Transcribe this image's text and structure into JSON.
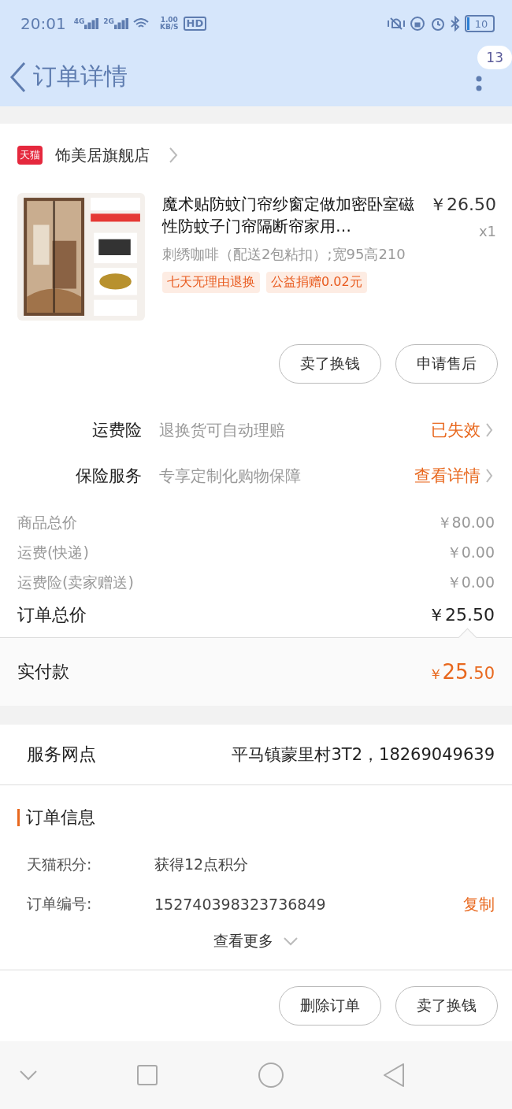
{
  "status_bar": {
    "time": "20:01",
    "signals": [
      "4G",
      "2G"
    ],
    "speed": "1.00",
    "speed_unit": "KB/S",
    "hd": "HD",
    "battery": "10"
  },
  "header": {
    "title": "订单详情",
    "badge": "13"
  },
  "store": {
    "badge": "天猫",
    "name": "饰美居旗舰店"
  },
  "product": {
    "image": {
      "kind": "picture"
    },
    "title": "魔术贴防蚊门帘纱窗定做加密卧室磁性防蚊子门帘隔断帘家用…",
    "price": "￥26.50",
    "quantity": "x1",
    "spec": "刺绣咖啡（配送2包粘扣）;宽95高210",
    "tags": [
      "七天无理由退换",
      "公益捐赠0.02元"
    ]
  },
  "item_buttons": [
    "卖了换钱",
    "申请售后"
  ],
  "services": [
    {
      "label": "运费险",
      "desc": "退换货可自动理赔",
      "action": "已失效"
    },
    {
      "label": "保险服务",
      "desc": "专享定制化购物保障",
      "action": "查看详情"
    }
  ],
  "summary": [
    {
      "label": "商品总价",
      "value": "￥80.00"
    },
    {
      "label": "运费(快递)",
      "value": "￥0.00"
    },
    {
      "label": "运费险(卖家赠送)",
      "value": "￥0.00"
    }
  ],
  "order_total": {
    "label": "订单总价",
    "value": "￥25.50"
  },
  "paid": {
    "label": "实付款",
    "currency": "￥",
    "integer": "25",
    "decimal": ".50"
  },
  "service_point": {
    "label": "服务网点",
    "value": "平马镇蒙里村3T2，18269049639"
  },
  "order_info": {
    "title": "订单信息",
    "rows": [
      {
        "label": "天猫积分:",
        "value": "获得12点积分"
      },
      {
        "label": "订单编号:",
        "value": "152740398323736849",
        "action": "复制"
      }
    ],
    "more": "查看更多"
  },
  "bottom_buttons": [
    "删除订单",
    "卖了换钱"
  ]
}
